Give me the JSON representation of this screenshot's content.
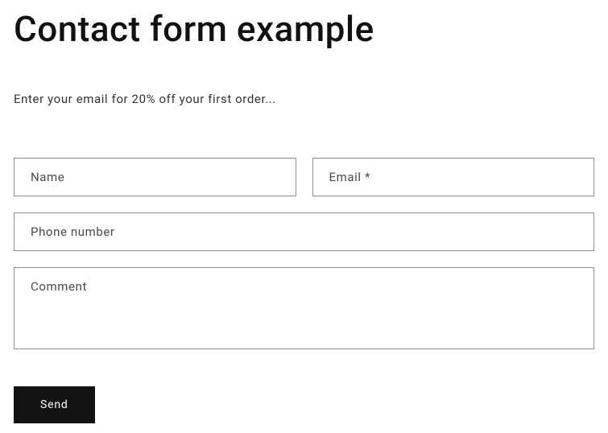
{
  "heading": "Contact form example",
  "subtext": "Enter your email for 20% off your first order...",
  "fields": {
    "name": {
      "placeholder": "Name"
    },
    "email": {
      "placeholder": "Email *"
    },
    "phone": {
      "placeholder": "Phone number"
    },
    "comment": {
      "placeholder": "Comment"
    }
  },
  "submit_label": "Send"
}
